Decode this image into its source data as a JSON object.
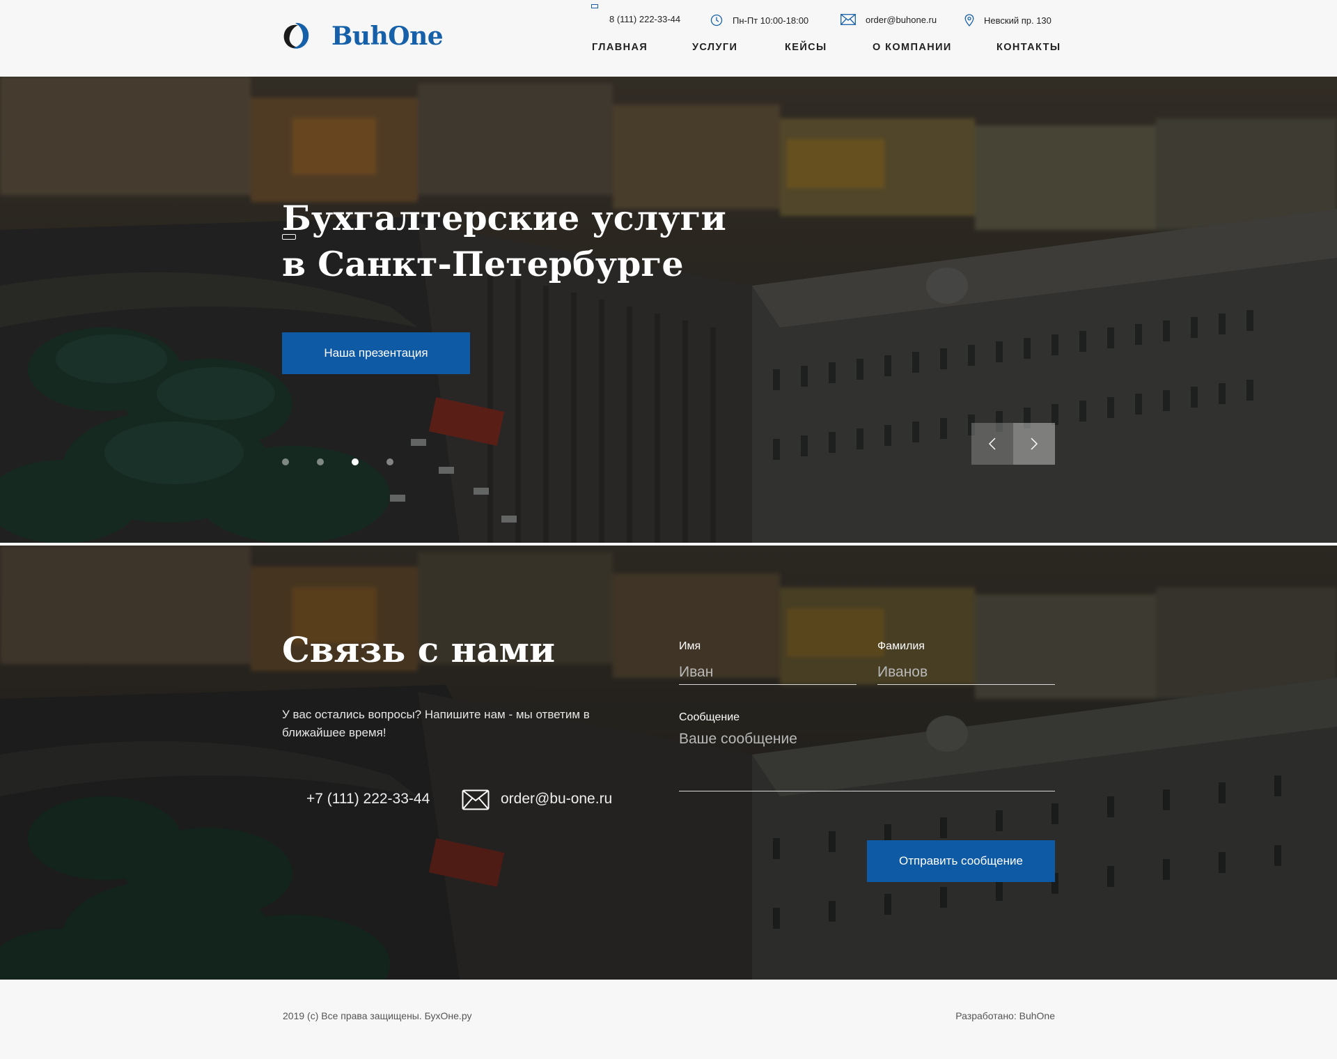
{
  "brand": {
    "name": "BuhOne",
    "color": "#1560a9"
  },
  "header": {
    "phone": "8 (111) 222-33-44",
    "hours": "Пн-Пт 10:00-18:00",
    "email": "order@buhone.ru",
    "address": "Невский пр. 130",
    "nav": [
      {
        "label": "ГЛАВНАЯ"
      },
      {
        "label": "УСЛУГИ"
      },
      {
        "label": "КЕЙСЫ"
      },
      {
        "label": "О КОМПАНИИ"
      },
      {
        "label": "КОНТАКТЫ"
      }
    ]
  },
  "hero": {
    "title_line1": "Бухгалтерские услуги",
    "title_line2": "в Санкт-Петербурге",
    "button_label": "Наша презентация",
    "slides_count": 4,
    "active_slide": 3
  },
  "contact": {
    "title": "Связь с нами",
    "text": "У вас остались вопросы? Напишите нам - мы ответим в ближайшее время!",
    "phone": "+7 (111) 222-33-44",
    "email": "order@bu-one.ru",
    "form": {
      "name_label": "Имя",
      "name_placeholder": "Иван",
      "lastname_label": "Фамилия",
      "lastname_placeholder": "Иванов",
      "message_label": "Сообщение",
      "message_placeholder": "Ваше сообщение",
      "submit_label": "Отправить сообщение"
    }
  },
  "footer": {
    "copyright": "2019 (c) Все права защищены. БухОне.ру",
    "developed_by": "Разработано: BuhOne"
  },
  "colors": {
    "accent": "#0f5aa5",
    "background": "#f7f7f7"
  }
}
